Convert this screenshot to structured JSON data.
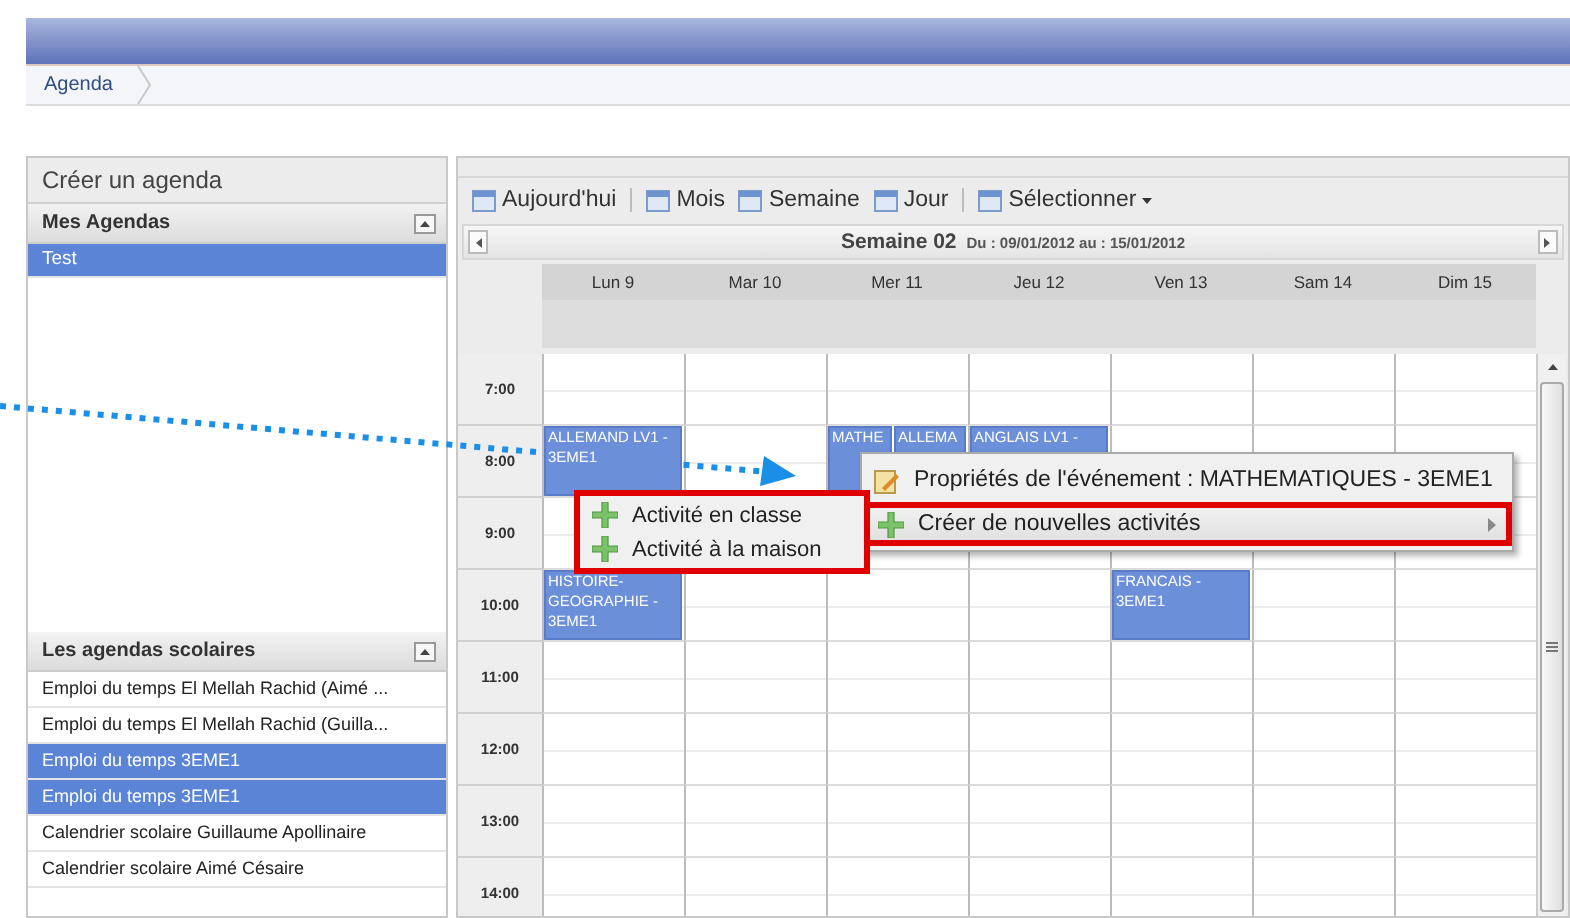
{
  "breadcrumb": [
    "Agenda"
  ],
  "left_panel": {
    "create_label": "Créer un agenda",
    "my_agendas": {
      "title": "Mes Agendas",
      "items": [
        {
          "label": "Test",
          "selected": true
        }
      ]
    },
    "school_agendas": {
      "title": "Les agendas scolaires",
      "items": [
        {
          "label": "Emploi du temps El Mellah Rachid (Aimé ...",
          "selected": false
        },
        {
          "label": "Emploi du temps El Mellah Rachid (Guilla...",
          "selected": false
        },
        {
          "label": "Emploi du temps 3EME1",
          "selected": true
        },
        {
          "label": "Emploi du temps 3EME1",
          "selected": true
        },
        {
          "label": "Calendrier scolaire Guillaume Apollinaire",
          "selected": false
        },
        {
          "label": "Calendrier scolaire Aimé Césaire",
          "selected": false
        }
      ]
    }
  },
  "toolbar": [
    {
      "kind": "button",
      "label": "Aujourd'hui",
      "dropdown": false
    },
    {
      "kind": "separator"
    },
    {
      "kind": "button",
      "label": "Mois",
      "dropdown": false
    },
    {
      "kind": "button",
      "label": "Semaine",
      "dropdown": false
    },
    {
      "kind": "button",
      "label": "Jour",
      "dropdown": false
    },
    {
      "kind": "separator"
    },
    {
      "kind": "button",
      "label": "Sélectionner",
      "dropdown": true
    }
  ],
  "week_nav": {
    "title": "Semaine 02",
    "range": "Du : 09/01/2012 au : 15/01/2012"
  },
  "days": [
    "Lun 9",
    "Mar 10",
    "Mer 11",
    "Jeu 12",
    "Ven 13",
    "Sam 14",
    "Dim 15"
  ],
  "hours": [
    {
      "label": "7:00"
    },
    {
      "label": "8:00",
      "cells": [
        {
          "events": [
            {
              "title": "ALLEMAND LV1 - 3EME1"
            }
          ]
        },
        {},
        {
          "events": [
            {
              "title": "MATHE"
            },
            {
              "title": "ALLEMA"
            }
          ]
        },
        {
          "events": [
            {
              "title": "ANGLAIS LV1 -"
            }
          ]
        }
      ]
    },
    {
      "label": "9:00"
    },
    {
      "label": "10:00",
      "cells": [
        {
          "events": [
            {
              "title": "HISTOIRE-GEOGRAPHIE - 3EME1"
            }
          ]
        },
        {},
        {},
        {},
        {
          "events": [
            {
              "title": "FRANCAIS - 3EME1"
            }
          ]
        }
      ]
    },
    {
      "label": "11:00"
    },
    {
      "label": "12:00"
    },
    {
      "label": "13:00"
    },
    {
      "label": "14:00"
    }
  ],
  "context_menu": {
    "items": [
      {
        "label": "Propriétés de l'événement : MATHEMATIQUES - 3EME1",
        "kind": "properties",
        "selected": false,
        "submenu": false
      },
      {
        "label": "Créer de nouvelles activités",
        "kind": "create",
        "selected": true,
        "submenu": true
      }
    ]
  },
  "submenu": {
    "items": [
      {
        "label": "Activité en classe"
      },
      {
        "label": "Activité à la maison"
      }
    ]
  }
}
